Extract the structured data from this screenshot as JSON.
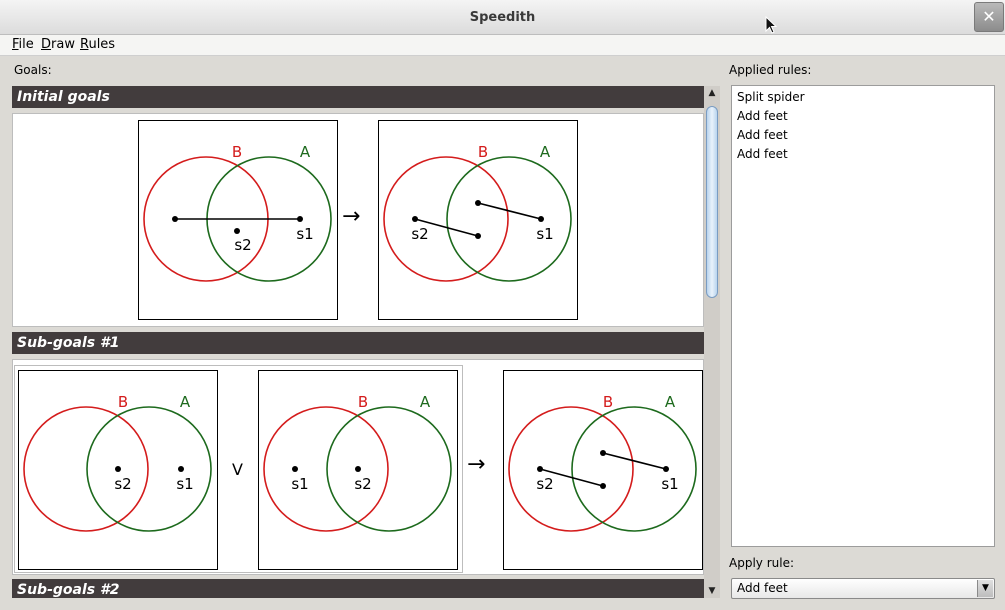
{
  "window": {
    "title": "Speedith",
    "close_glyph": "✕"
  },
  "menu": [
    {
      "key": "F",
      "rest": "ile"
    },
    {
      "key": "D",
      "rest": "raw"
    },
    {
      "key": "R",
      "rest": "ules"
    }
  ],
  "goals_label": "Goals:",
  "sections": {
    "initial": "Initial goals",
    "sub1": "Sub-goals #1",
    "sub2": "Sub-goals #2"
  },
  "diagram_labels": {
    "contour_b": "B",
    "contour_a": "A",
    "spider_1": "s1",
    "spider_2": "s2",
    "implies": "→",
    "disjunction": "V"
  },
  "applied_rules": {
    "label": "Applied rules:",
    "items": [
      "Split spider",
      "Add feet",
      "Add feet",
      "Add feet"
    ]
  },
  "apply_rule": {
    "label": "Apply rule:",
    "selected": "Add feet"
  },
  "colors": {
    "contour_b": "#d41c1c",
    "contour_a": "#1d6a1d",
    "header_bg": "#423c3d"
  }
}
